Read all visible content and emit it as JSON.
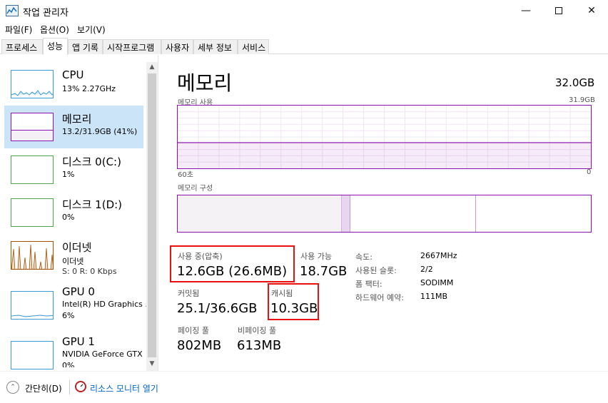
{
  "window": {
    "title": "작업 관리자",
    "min_glyph": "—",
    "close_glyph": "✕"
  },
  "menu": [
    {
      "label": "파일(F)"
    },
    {
      "label": "옵션(O)"
    },
    {
      "label": "보기(V)"
    }
  ],
  "tabs": [
    {
      "label": "프로세스",
      "active": false
    },
    {
      "label": "성능",
      "active": true
    },
    {
      "label": "앱 기록",
      "active": false
    },
    {
      "label": "시작프로그램",
      "active": false
    },
    {
      "label": "사용자",
      "active": false
    },
    {
      "label": "세부 정보",
      "active": false
    },
    {
      "label": "서비스",
      "active": false
    }
  ],
  "sidebar": {
    "items": [
      {
        "title": "CPU",
        "sub": "13% 2.27GHz"
      },
      {
        "title": "메모리",
        "sub": "13.2/31.9GB (41%)",
        "selected": true
      },
      {
        "title": "디스크 0(C:)",
        "sub": "1%"
      },
      {
        "title": "디스크 1(D:)",
        "sub": "0%"
      },
      {
        "title": "이더넷",
        "sub": "이더넷",
        "sub2": "S: 0 R: 0 Kbps"
      },
      {
        "title": "GPU 0",
        "sub": "Intel(R) HD Graphics .",
        "sub2": "6%"
      },
      {
        "title": "GPU 1",
        "sub": "NVIDIA GeForce GTX",
        "sub2": "0%"
      }
    ],
    "scroll_up": "▲",
    "scroll_down": "▼"
  },
  "main": {
    "title": "메모리",
    "total": "32.0GB",
    "usage_label": "메모리 사용",
    "usage_max": "31.9GB",
    "usage_fraction": 0.41,
    "time_left": "60초",
    "time_right": "0",
    "composition_label": "메모리 구성",
    "stats": {
      "in_use_label": "사용 중(압축)",
      "in_use_value": "12.6GB (26.6MB)",
      "available_label": "사용 가능",
      "available_value": "18.7GB",
      "committed_label": "커밋됨",
      "committed_value": "25.1/36.6GB",
      "cached_label": "캐시됨",
      "cached_value": "10.3GB",
      "paged_label": "페이징 풀",
      "paged_value": "802MB",
      "nonpaged_label": "비페이징 풀",
      "nonpaged_value": "613MB"
    },
    "props": [
      {
        "key": "속도:",
        "value": "2667MHz"
      },
      {
        "key": "사용된 슬롯:",
        "value": "2/2"
      },
      {
        "key": "폼 팩터:",
        "value": "SODIMM"
      },
      {
        "key": "하드웨어 예약:",
        "value": "111MB"
      }
    ]
  },
  "footer": {
    "fewer_details": "간단히(D)",
    "fewer_glyph": "⌃",
    "resource_monitor": "리소스 모니터 열기"
  },
  "colors": {
    "memory": "#8b12ae",
    "cpu": "#3b9bd6",
    "disk": "#4da34d",
    "net": "#a74f01",
    "highlight": "#e81010",
    "selected": "#cce4f7"
  }
}
